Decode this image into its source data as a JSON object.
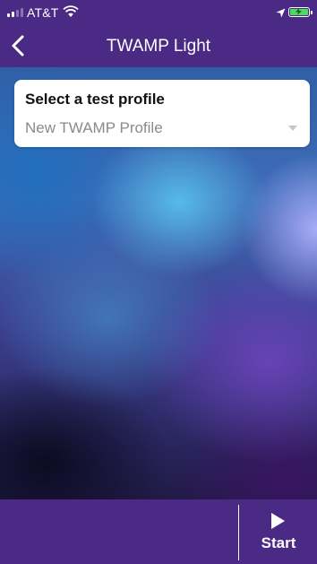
{
  "status_bar": {
    "carrier": "AT&T",
    "signal_bars_filled": 2,
    "signal_bars_total": 4,
    "wifi_icon": "wifi-icon",
    "location_icon": "location-arrow-icon",
    "battery_icon": "battery-charging-icon",
    "battery_color": "#4cd964"
  },
  "nav": {
    "title": "TWAMP Light",
    "back_icon": "chevron-left-icon"
  },
  "profile_card": {
    "label": "Select a test profile",
    "selected_value": "New TWAMP Profile",
    "dropdown_icon": "caret-down-icon"
  },
  "bottom_bar": {
    "start_label": "Start",
    "start_icon": "play-icon"
  },
  "colors": {
    "bar_background": "#4b2a86",
    "card_background": "#ffffff",
    "text_primary": "#111111",
    "text_placeholder": "#8a8a8a"
  }
}
